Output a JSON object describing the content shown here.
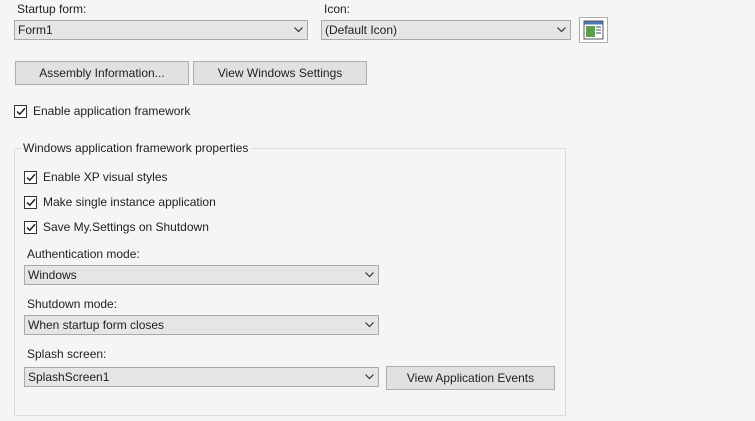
{
  "startup": {
    "label": "Startup form:",
    "value": "Form1"
  },
  "icon": {
    "label": "Icon:",
    "value": "(Default Icon)",
    "preview_icon": "application-window-icon"
  },
  "buttons": {
    "assembly_info": "Assembly Information...",
    "view_windows_settings": "View Windows Settings",
    "view_app_events": "View Application Events"
  },
  "app_framework": {
    "label": "Enable application framework",
    "checked": true
  },
  "framework_group": {
    "title": "Windows application framework properties",
    "options": [
      {
        "label": "Enable XP visual styles",
        "checked": true
      },
      {
        "label": "Make single instance application",
        "checked": true
      },
      {
        "label": "Save My.Settings on Shutdown",
        "checked": true
      }
    ],
    "authentication": {
      "label": "Authentication mode:",
      "value": "Windows"
    },
    "shutdown": {
      "label": "Shutdown mode:",
      "value": "When startup form closes"
    },
    "splash": {
      "label": "Splash screen:",
      "value": "SplashScreen1"
    }
  },
  "colors": {
    "background": "#f5f5f5",
    "combo_background": "#e5e5e5",
    "button_background": "#e1e1e1",
    "border": "#a9a9a9"
  }
}
